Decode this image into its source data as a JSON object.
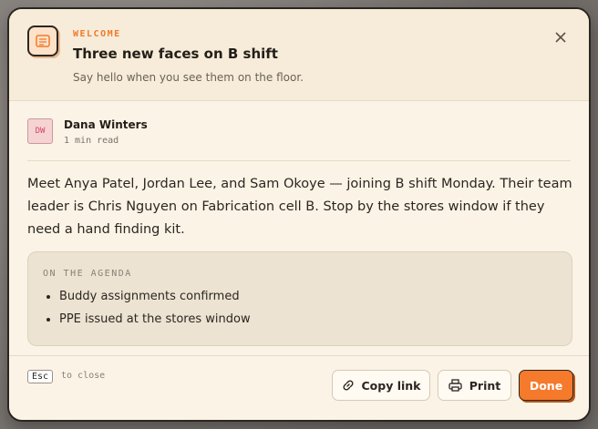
{
  "modal": {
    "eyebrow": "WELCOME",
    "title": "Three new faces on B shift",
    "subtitle": "Say hello when you see them on the floor.",
    "close_icon": "close-icon"
  },
  "author": {
    "initials": "DW",
    "name": "Dana Winters",
    "read_time": "1 min read"
  },
  "body": {
    "text": "Meet Anya Patel, Jordan Lee, and Sam Okoye — joining B shift Monday. Their team leader is Chris Nguyen on Fabrication cell B. Stop by the stores window if they need a hand finding kit."
  },
  "agenda": {
    "label": "ON THE AGENDA",
    "items": [
      "Buddy assignments confirmed",
      "PPE issued at the stores window"
    ]
  },
  "footer": {
    "kbd": "Esc",
    "hint": "to close",
    "copy_label": "Copy link",
    "print_label": "Print",
    "done_label": "Done"
  },
  "colors": {
    "accent": "#f57a2c",
    "surface": "#fbf3e6",
    "ink": "#2b2620"
  }
}
